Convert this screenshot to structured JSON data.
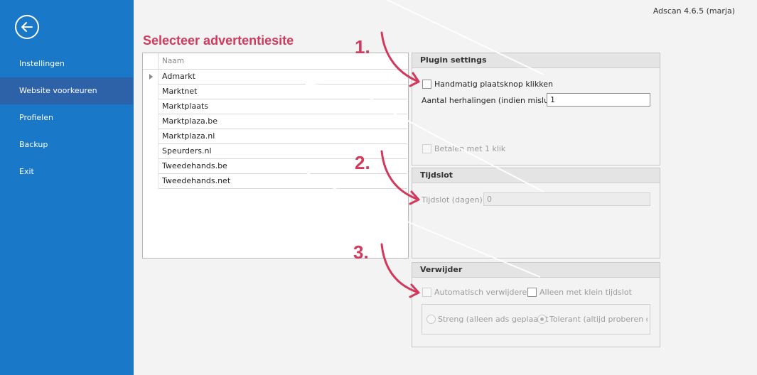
{
  "app": {
    "version": "Adscan 4.6.5 (marja)"
  },
  "sidebar": {
    "items": [
      {
        "label": "Instellingen"
      },
      {
        "label": "Website voorkeuren"
      },
      {
        "label": "Profielen"
      },
      {
        "label": "Backup"
      },
      {
        "label": "Exit"
      }
    ]
  },
  "main": {
    "title": "Selecteer advertentiesite",
    "list": {
      "header": "Naam",
      "rows": [
        "Admarkt",
        "Marktnet",
        "Marktplaats",
        "Marktplaza.be",
        "Marktplaza.nl",
        "Speurders.nl",
        "Tweedehands.be",
        "Tweedehands.net"
      ]
    },
    "plugin_settings": {
      "title": "Plugin settings",
      "manual_click_label": "Handmatig plaatsknop klikken",
      "repeat_label": "Aantal herhalingen (indien mislukt)",
      "repeat_value": "1",
      "pay_one_click_label": "Betalen met 1 klik"
    },
    "timeslot": {
      "title": "Tijdslot",
      "days_label": "Tijdslot (dagen)",
      "days_value": "0"
    },
    "delete": {
      "title": "Verwijder",
      "auto_delete_label": "Automatisch verwijderen",
      "small_slot_label": "Alleen met klein tijdslot",
      "strict_label": "Streng (alleen ads geplaatst",
      "tolerant_label": "Tolerant (altijd proberen de a"
    }
  },
  "annotations": {
    "steps": [
      "1.",
      "2.",
      "3."
    ],
    "color": "#d13a5c"
  },
  "colors": {
    "sidebar": "#1a78c8",
    "sidebar_active": "#2d62a8",
    "accent": "#d13a5c"
  }
}
